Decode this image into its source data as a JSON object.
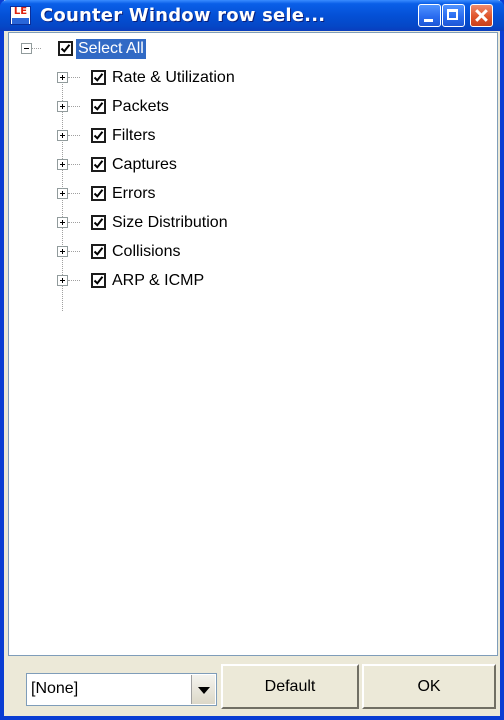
{
  "window": {
    "title": "Counter Window row sele...",
    "icon": "le-app-icon",
    "controls": [
      "minimize",
      "maximize",
      "close"
    ]
  },
  "tree": {
    "root": {
      "label": "Select All",
      "checked": true,
      "expanded": true,
      "selected": true
    },
    "items": [
      {
        "label": "Rate & Utilization",
        "checked": true,
        "expanded": false
      },
      {
        "label": "Packets",
        "checked": true,
        "expanded": false
      },
      {
        "label": "Filters",
        "checked": true,
        "expanded": false
      },
      {
        "label": "Captures",
        "checked": true,
        "expanded": false
      },
      {
        "label": "Errors",
        "checked": true,
        "expanded": false
      },
      {
        "label": "Size Distribution",
        "checked": true,
        "expanded": false
      },
      {
        "label": "Collisions",
        "checked": true,
        "expanded": false
      },
      {
        "label": "ARP & ICMP",
        "checked": true,
        "expanded": false
      }
    ]
  },
  "footer": {
    "dropdown_value": "[None]",
    "default_label": "Default",
    "ok_label": "OK"
  },
  "colors": {
    "titlebar": "#0450d6",
    "selection": "#316ac5",
    "dialog_bg": "#ece9d8"
  }
}
